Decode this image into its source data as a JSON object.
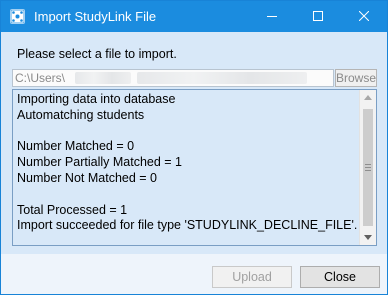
{
  "window": {
    "title": "Import StudyLink File",
    "app_icon": "app-dialog-icon",
    "controls": [
      "minimize-icon",
      "maximize-icon",
      "close-icon"
    ]
  },
  "main": {
    "prompt": "Please select a file to import.",
    "path_value": "C:\\Users\\",
    "browse_label": "Browse",
    "log_lines": [
      "Importing data into database",
      "Automatching students",
      "",
      "Number Matched = 0",
      "Number Partially Matched = 1",
      "Number Not Matched = 0",
      "",
      "Total Processed = 1",
      "Import succeeded for file type 'STUDYLINK_DECLINE_FILE'."
    ]
  },
  "footer": {
    "upload_label": "Upload",
    "close_label": "Close"
  },
  "colors": {
    "titlebar": "#1b8cdf",
    "dialog_bg": "#d8e8f8",
    "log_border": "#7a9ec4"
  }
}
